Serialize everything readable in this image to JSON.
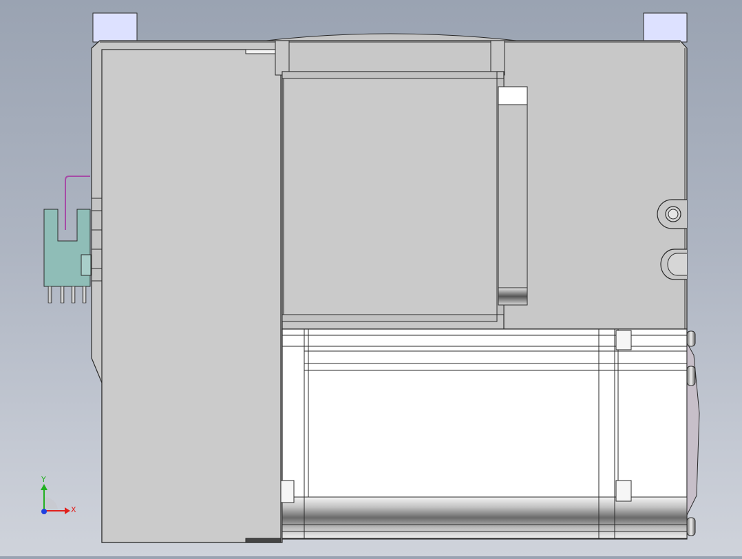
{
  "viewport": {
    "background_top": "#9aa3b2",
    "background_bottom": "#cfd3db"
  },
  "model": {
    "body_color": "#c8c8c8",
    "panel_color": "#cbcbcb",
    "outline_color": "#2a2a2a",
    "bracket_color": "#dde1ff",
    "connector_color": "#8fbdb7",
    "wire_color": "#a64aa6",
    "motor_color": "#ffffff"
  },
  "triad": {
    "x_label": "X",
    "y_label": "Y",
    "x_color": "#e0201c",
    "y_color": "#20b020",
    "z_color": "#2040e0"
  }
}
